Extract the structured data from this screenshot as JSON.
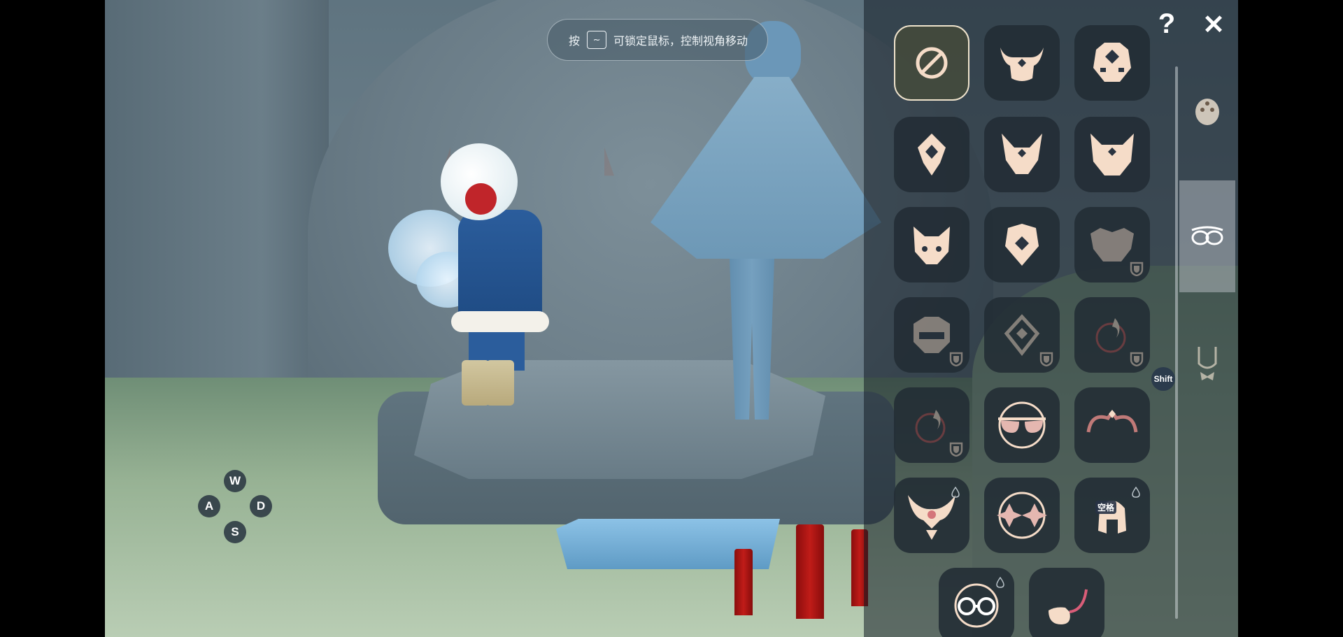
{
  "hud": {
    "hint_prefix": "按",
    "hint_key": "~",
    "hint_text": "可锁定鼠标，控制视角移动"
  },
  "controls": {
    "w": "W",
    "a": "A",
    "s": "S",
    "d": "D",
    "shift": "Shift"
  },
  "panel": {
    "help_label": "?",
    "close_label": "✕",
    "empty_slot_symbol": "∅",
    "swap_badge": "空格",
    "accent_color": "#f5dcc8",
    "slots": [
      {
        "icon": "none-icon",
        "state": "selected"
      },
      {
        "icon": "horned-mask-icon",
        "state": "owned"
      },
      {
        "icon": "diamond-mask-icon",
        "state": "owned"
      },
      {
        "icon": "gem-mask-icon",
        "state": "owned"
      },
      {
        "icon": "fox-mask-icon",
        "state": "owned"
      },
      {
        "icon": "oni-mask-icon",
        "state": "owned"
      },
      {
        "icon": "cat-mask-icon",
        "state": "owned"
      },
      {
        "icon": "shield-mask-icon",
        "state": "owned"
      },
      {
        "icon": "crown-mask-icon",
        "state": "locked"
      },
      {
        "icon": "visor-mask-icon",
        "state": "locked"
      },
      {
        "icon": "diamond-outline-mask-icon",
        "state": "locked"
      },
      {
        "icon": "flame-mask-icon",
        "state": "locked"
      },
      {
        "icon": "flame-mask-2-icon",
        "state": "locked"
      },
      {
        "icon": "sunglasses-icon",
        "state": "owned"
      },
      {
        "icon": "swirl-mask-icon",
        "state": "owned"
      },
      {
        "icon": "winged-mask-icon",
        "state": "owned"
      },
      {
        "icon": "star-glasses-icon",
        "state": "owned"
      },
      {
        "icon": "swap-mask-icon",
        "state": "owned"
      },
      {
        "icon": "round-glasses-icon",
        "state": "owned"
      },
      {
        "icon": "pipe-icon",
        "state": "owned"
      }
    ],
    "categories": [
      {
        "icon": "face-icon",
        "active": false
      },
      {
        "icon": "glasses-category-icon",
        "active": true
      },
      {
        "icon": "necklace-icon",
        "active": false
      }
    ]
  }
}
